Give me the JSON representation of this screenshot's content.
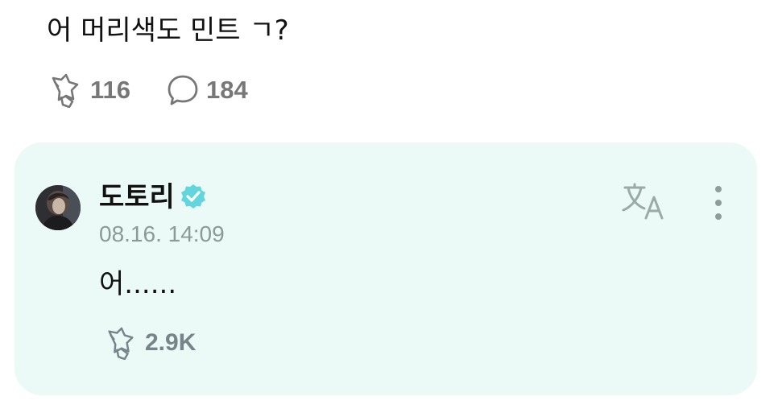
{
  "post": {
    "text": "어 머리색도 민트 ㄱ?",
    "like_count": "116",
    "comment_count": "184",
    "like_icon": "star-burst-like-icon",
    "comment_icon": "speech-bubble-icon"
  },
  "reply": {
    "author": "도토리",
    "verified_icon": "verified-badge-icon",
    "timestamp": "08.16. 14:09",
    "text": "어......",
    "like_count": "2.9K",
    "translate_icon": "translate-icon",
    "more_icon": "more-vertical-icon"
  },
  "colors": {
    "card_background": "#ebfaf7",
    "verified_badge": "#62d6dc",
    "muted_text": "#8c9a97"
  }
}
